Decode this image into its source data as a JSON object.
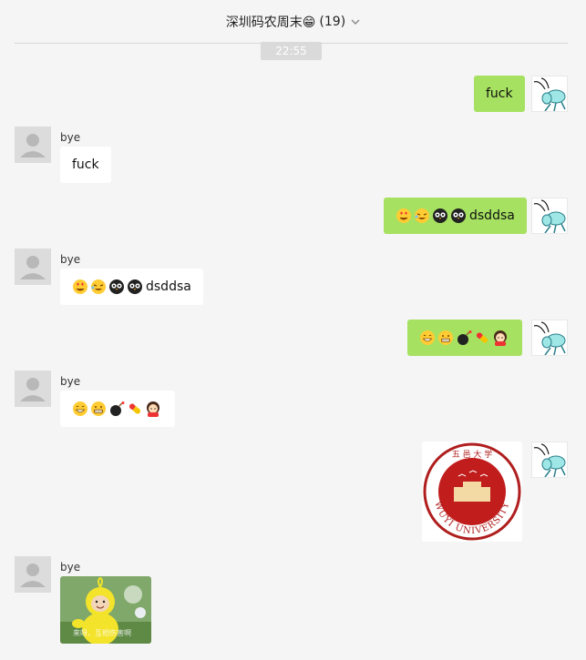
{
  "header": {
    "title": "深圳码农周末😁",
    "count": "(19)"
  },
  "timestamp": "22:55",
  "messages": [
    {
      "sender": "",
      "text": "fuck"
    },
    {
      "sender": "bye",
      "text": "fuck"
    },
    {
      "sender": "",
      "emojis": [
        "heart-eyes-icon",
        "laughing-tears-icon",
        "owl-icon",
        "owl-icon"
      ],
      "text": "dsddsa"
    },
    {
      "sender": "bye",
      "emojis": [
        "heart-eyes-icon",
        "laughing-tears-icon",
        "owl-icon",
        "owl-icon"
      ],
      "text": "dsddsa"
    },
    {
      "sender": "",
      "emojis": [
        "grin-icon",
        "grimace-icon",
        "bomb-icon",
        "pill-icon",
        "girl-icon"
      ]
    },
    {
      "sender": "bye",
      "emojis": [
        "grin-icon",
        "grimace-icon",
        "bomb-icon",
        "pill-icon",
        "girl-icon"
      ]
    },
    {
      "sender": "",
      "image": "wuyi-university-seal",
      "image_text": "WUYI UNIVERSITY"
    },
    {
      "sender": "bye",
      "image": "teletubby-sticker",
      "image_text": "来呀，互相伤害啊"
    }
  ],
  "colors": {
    "self_bubble": "#a6e161",
    "other_bubble": "#ffffff",
    "background": "#f5f5f5"
  }
}
